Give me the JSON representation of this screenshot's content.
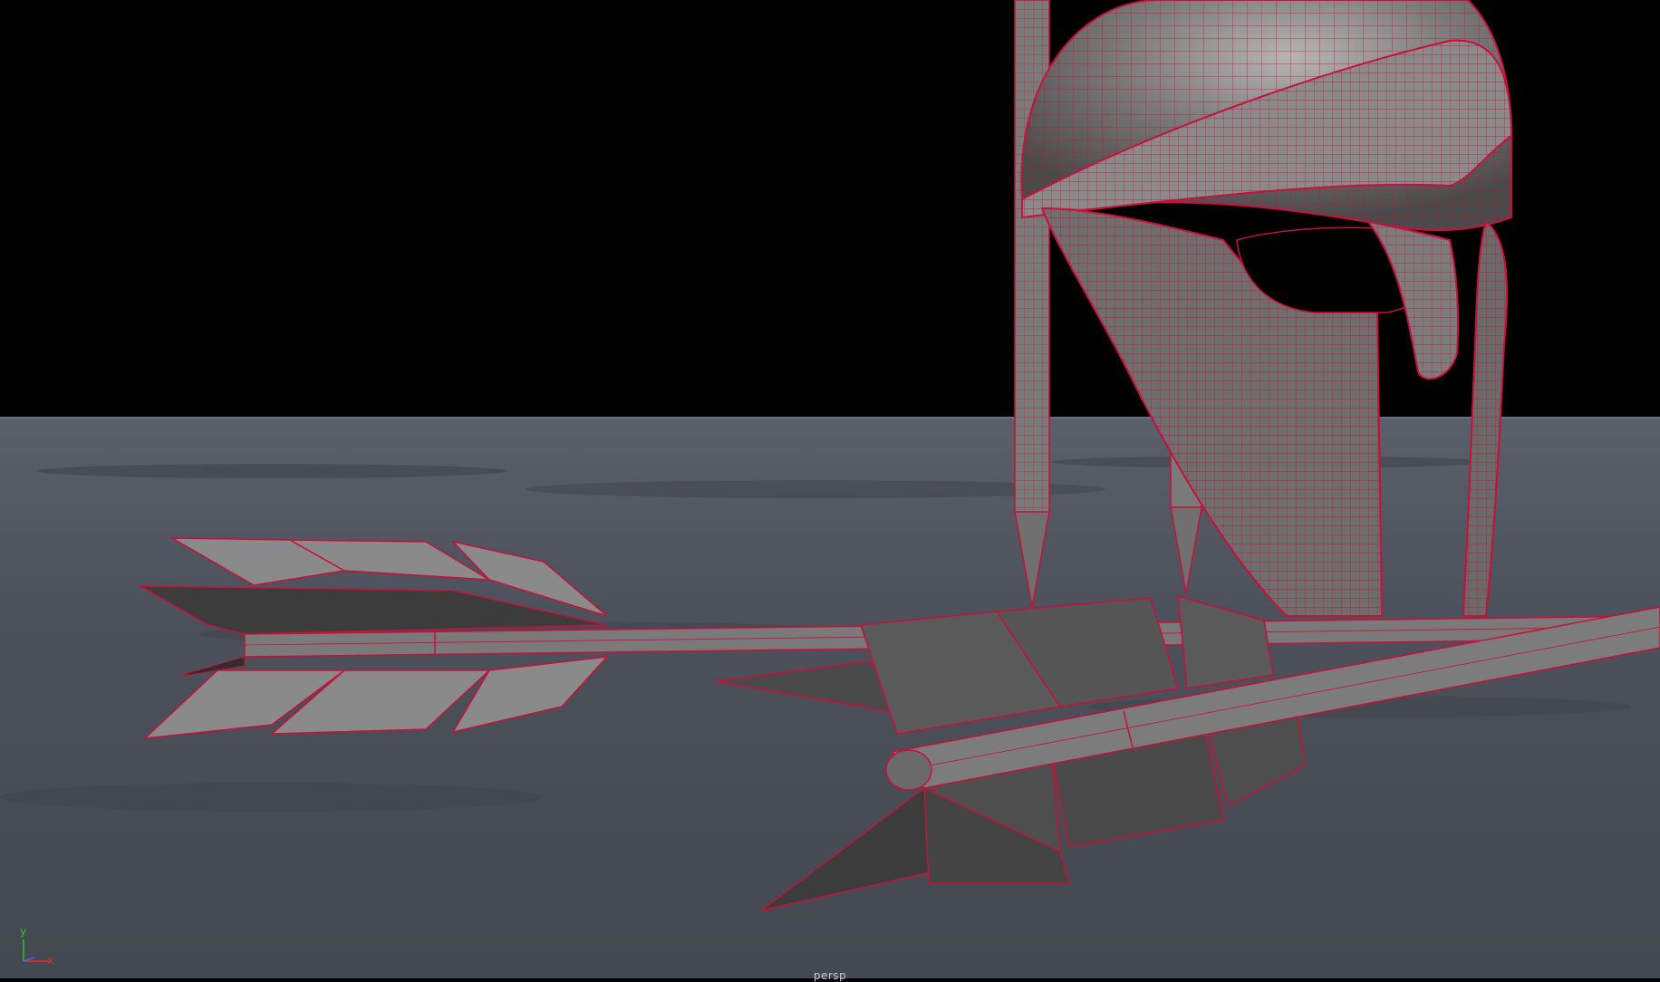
{
  "viewport": {
    "camera_name": "persp",
    "axis": {
      "y_label": "y",
      "x_label": "x",
      "z_label": "z"
    },
    "colors": {
      "sky": "#000000",
      "ground": "#4a4f58",
      "horizon": "#5d6277",
      "mesh_fill": "#6c6c6c",
      "mesh_dark": "#3e3e3e",
      "wireframe": "#c8103a",
      "axis_x": "#e03030",
      "axis_y": "#30c030",
      "axis_z": "#3070ff"
    },
    "objects": [
      "helmet",
      "arrow-upper",
      "arrow-lower",
      "spear-shaft"
    ]
  }
}
